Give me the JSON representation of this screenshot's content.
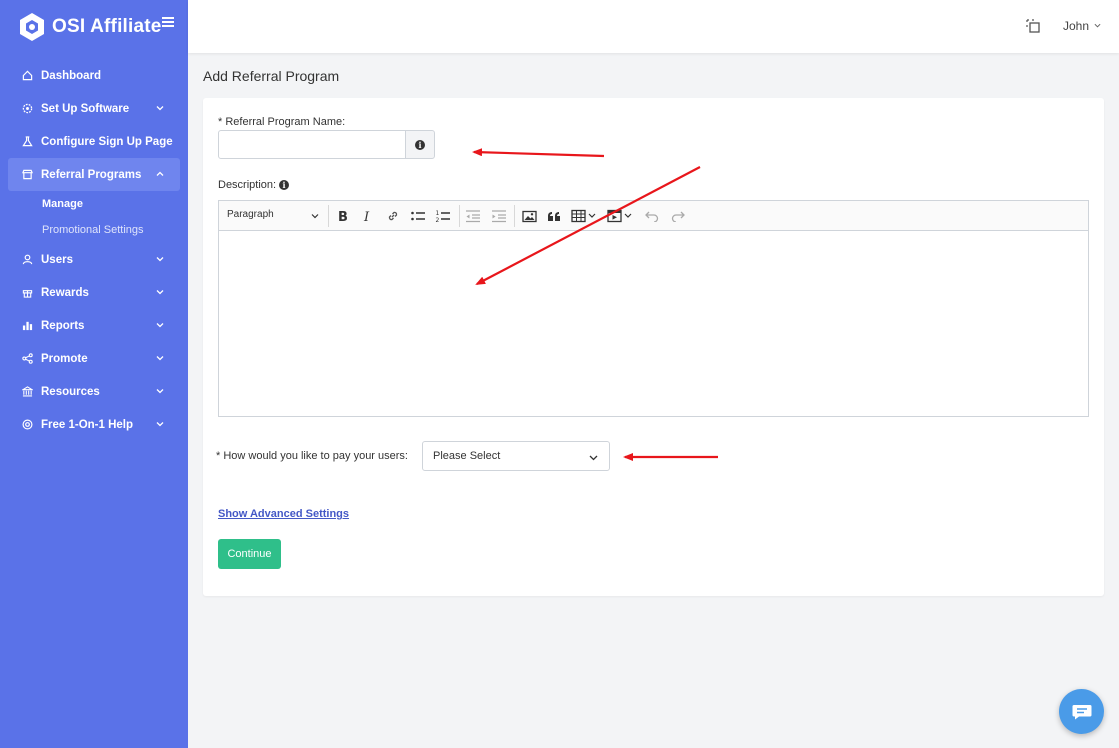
{
  "brand": {
    "name": "OSI Affiliate"
  },
  "sidebar": {
    "items": [
      {
        "label": "Dashboard",
        "icon": "home-icon"
      },
      {
        "label": "Set Up Software",
        "icon": "gear-icon",
        "has_chevron": true
      },
      {
        "label": "Configure Sign Up Page",
        "icon": "flask-icon"
      },
      {
        "label": "Referral Programs",
        "icon": "store-icon",
        "has_chevron": true,
        "active": true,
        "subitems": [
          {
            "label": "Manage",
            "current": true
          },
          {
            "label": "Promotional Settings"
          }
        ]
      },
      {
        "label": "Users",
        "icon": "user-icon",
        "has_chevron": true
      },
      {
        "label": "Rewards",
        "icon": "gift-icon",
        "has_chevron": true
      },
      {
        "label": "Reports",
        "icon": "bar-chart-icon",
        "has_chevron": true
      },
      {
        "label": "Promote",
        "icon": "share-icon",
        "has_chevron": true
      },
      {
        "label": "Resources",
        "icon": "bank-icon",
        "has_chevron": true
      },
      {
        "label": "Free 1-On-1 Help",
        "icon": "lifebuoy-icon",
        "has_chevron": true
      }
    ]
  },
  "topbar": {
    "user_name": "John"
  },
  "page": {
    "title": "Add Referral Program"
  },
  "form": {
    "name_label": "* Referral Program Name:",
    "name_value": "",
    "description_label": "Description:",
    "editor": {
      "paragraph_format": "Paragraph"
    },
    "pay_label": "* How would you like to pay your users:",
    "pay_selected": "Please Select",
    "advanced_link": "Show Advanced Settings",
    "continue_label": "Continue"
  },
  "colors": {
    "sidebar": "#5a72e8",
    "sidebar_active": "#6f85ee",
    "continue_button": "#2fbf8a",
    "link": "#4458c6",
    "annotation_arrow": "#e8161b",
    "chat_button": "#4a9be8"
  }
}
